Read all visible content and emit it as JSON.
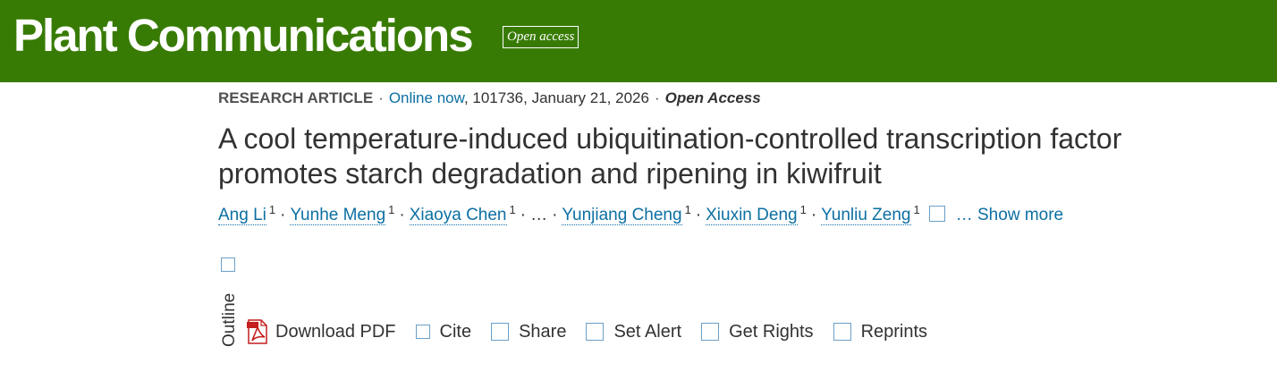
{
  "header": {
    "journal_name": "Plant Communications",
    "badge": "Open access",
    "brand_color": "#387b04"
  },
  "meta": {
    "article_type": "RESEARCH ARTICLE",
    "separator": "·",
    "online_label": "Online now",
    "details": ", 101736, January 21, 2026",
    "access": "Open Access"
  },
  "article": {
    "title": "A cool temperature-induced ubiquitination-controlled transcription factor promotes starch degradation and ripening in kiwifruit"
  },
  "authors": {
    "list": [
      {
        "name": "Ang Li",
        "aff": "1"
      },
      {
        "name": "Yunhe Meng",
        "aff": "1"
      },
      {
        "name": "Xiaoya Chen",
        "aff": "1"
      },
      {
        "name": "Yunjiang Cheng",
        "aff": "1"
      },
      {
        "name": "Xiuxin Deng",
        "aff": "1"
      },
      {
        "name": "Yunliu Zeng",
        "aff": "1"
      }
    ],
    "ellipsis": "…",
    "show_more": "… Show more",
    "link_color": "#0c6fa3"
  },
  "sidebar": {
    "outline_label": "Outline"
  },
  "toolbar": {
    "download_pdf": "Download PDF",
    "cite": "Cite",
    "share": "Share",
    "set_alert": "Set Alert",
    "get_rights": "Get Rights",
    "reprints": "Reprints"
  }
}
